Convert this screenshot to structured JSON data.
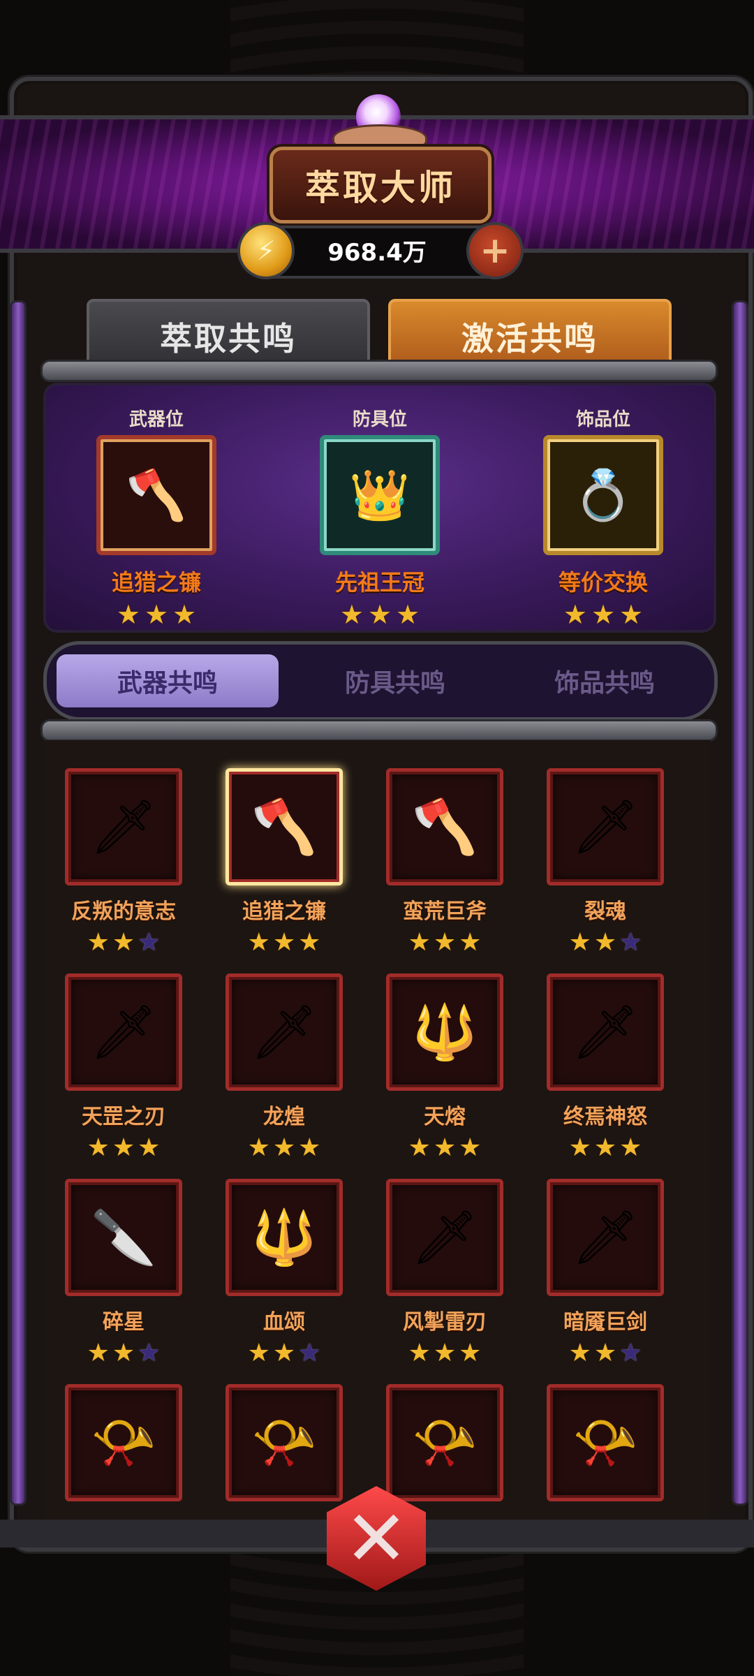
{
  "header": {
    "title": "萃取大师",
    "currency_amount": "968.4万",
    "plus_glyph": "+"
  },
  "top_tabs": [
    {
      "label": "萃取共鸣",
      "active": false
    },
    {
      "label": "激活共鸣",
      "active": true
    }
  ],
  "equipped": [
    {
      "slot_label": "武器位",
      "name": "追猎之镰",
      "stars": 3,
      "icon": "scythe-icon",
      "frame_color": "#a33a2a"
    },
    {
      "slot_label": "防具位",
      "name": "先祖王冠",
      "stars": 3,
      "icon": "crown-icon",
      "frame_color": "#2f8a7a"
    },
    {
      "slot_label": "饰品位",
      "name": "等价交换",
      "stars": 3,
      "icon": "ring-icon",
      "frame_color": "#b8892a"
    }
  ],
  "sub_tabs": [
    {
      "label": "武器共鸣",
      "active": true
    },
    {
      "label": "防具共鸣",
      "active": false
    },
    {
      "label": "饰品共鸣",
      "active": false
    }
  ],
  "items": [
    {
      "name": "反叛的意志",
      "stars": 2,
      "icon": "sword-icon",
      "selected": false
    },
    {
      "name": "追猎之镰",
      "stars": 3,
      "icon": "scythe-icon",
      "selected": true
    },
    {
      "name": "蛮荒巨斧",
      "stars": 3,
      "icon": "axe-icon",
      "selected": false
    },
    {
      "name": "裂魂",
      "stars": 2,
      "icon": "sword-icon",
      "selected": false
    },
    {
      "name": "天罡之刃",
      "stars": 3,
      "icon": "sword-icon",
      "selected": false
    },
    {
      "name": "龙煌",
      "stars": 3,
      "icon": "sword-icon",
      "selected": false
    },
    {
      "name": "天熔",
      "stars": 3,
      "icon": "mace-icon",
      "selected": false
    },
    {
      "name": "终焉神怒",
      "stars": 3,
      "icon": "sword-icon",
      "selected": false
    },
    {
      "name": "碎星",
      "stars": 2,
      "icon": "dagger-icon",
      "selected": false
    },
    {
      "name": "血颂",
      "stars": 2,
      "icon": "mace-icon",
      "selected": false
    },
    {
      "name": "风掣雷刃",
      "stars": 3,
      "icon": "sword-icon",
      "selected": false
    },
    {
      "name": "暗魇巨剑",
      "stars": 2,
      "icon": "sword-icon",
      "selected": false
    },
    {
      "name": "",
      "stars": 0,
      "icon": "horn-icon",
      "selected": false
    },
    {
      "name": "",
      "stars": 0,
      "icon": "horn-icon",
      "selected": false
    },
    {
      "name": "",
      "stars": 0,
      "icon": "horn-icon",
      "selected": false
    },
    {
      "name": "",
      "stars": 0,
      "icon": "horn-icon",
      "selected": false
    }
  ],
  "colors": {
    "accent_orange": "#f27a1a",
    "star_gold": "#f2b92d",
    "star_empty": "#3a2a7a",
    "item_frame_red": "#a12c2a"
  }
}
